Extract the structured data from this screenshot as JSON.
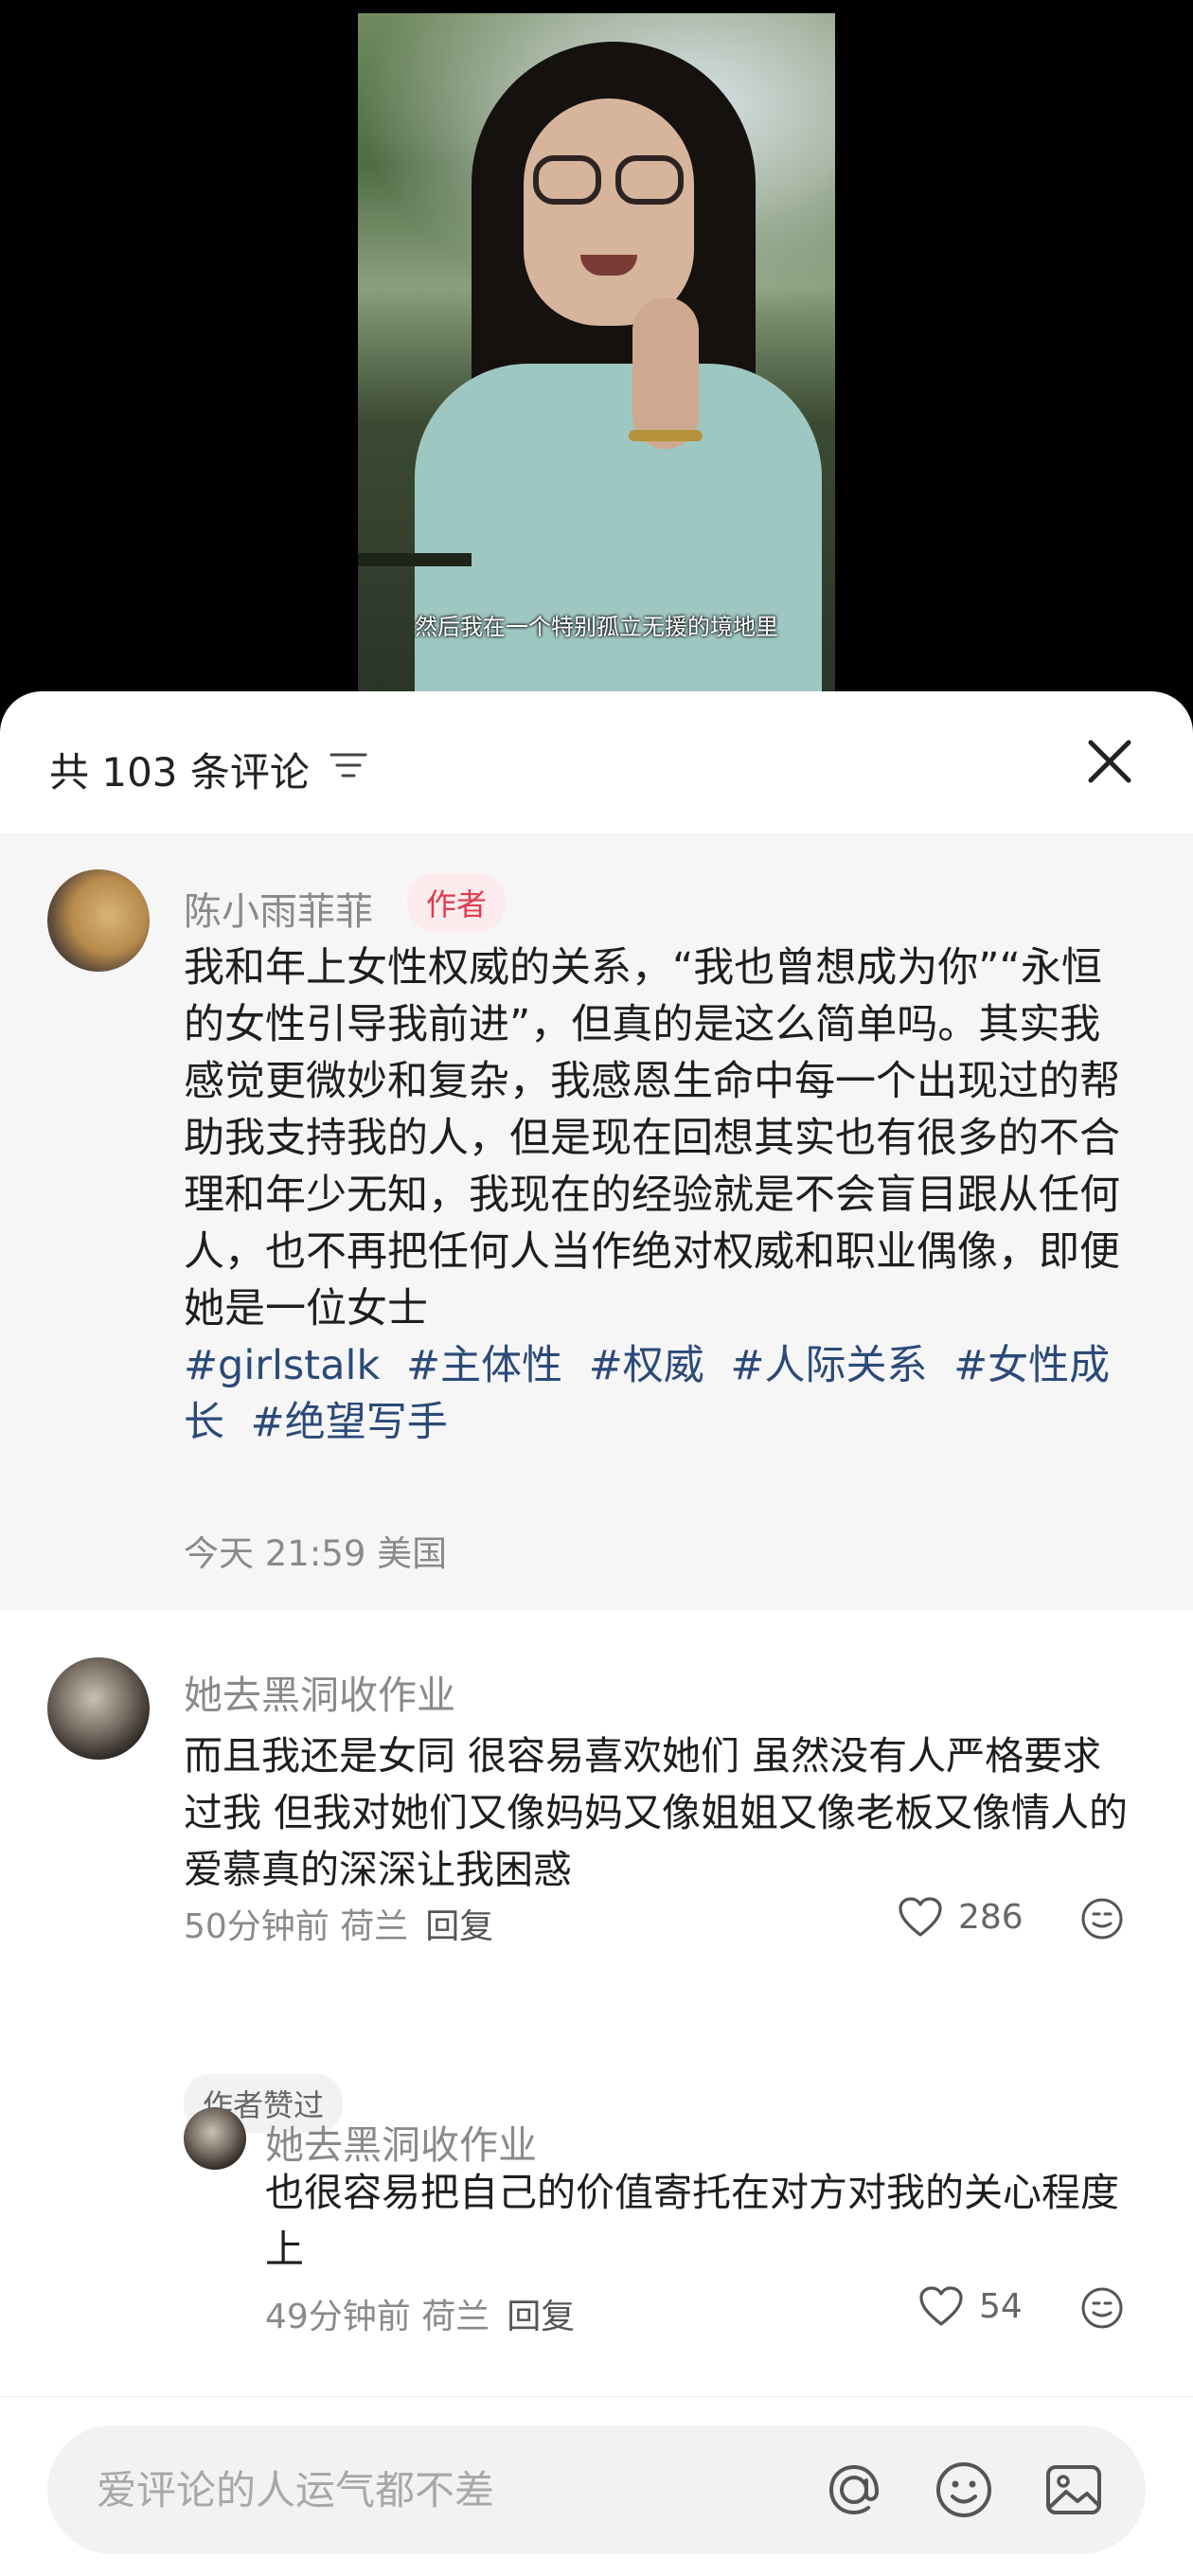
{
  "video": {
    "subtitle": "然后我在一个特别孤立无援的境地里"
  },
  "panel": {
    "title": "共 103 条评论"
  },
  "author_post": {
    "name": "陈小雨菲菲",
    "badge": "作者",
    "text": "我和年上女性权威的关系，“我也曾想成为你”“永恒的女性引导我前进”，但真的是这么简单吗。其实我感觉更微妙和复杂，我感恩生命中每一个出现过的帮助我支持我的人，但是现在回想其实也有很多的不合理和年少无知，我现在的经验就是不会盲目跟从任何人，也不再把任何人当作绝对权威和职业偶像，即便她是一位女士",
    "tags": [
      "#girlstalk",
      "#主体性",
      "#权威",
      "#人际关系",
      "#女性成长",
      "#绝望写手"
    ],
    "meta": "今天 21:59 美国"
  },
  "comments": [
    {
      "name": "她去黑洞收作业",
      "text": "而且我还是女同 很容易喜欢她们 虽然没有人严格要求过我 但我对她们又像妈妈又像姐姐又像老板又像情人的爱慕真的深深让我困惑",
      "time_location": "50分钟前 荷兰",
      "reply_label": "回复",
      "likes": "286",
      "badge": "作者赞过"
    }
  ],
  "replies": [
    {
      "name": "她去黑洞收作业",
      "text": "也很容易把自己的价值寄托在对方对我的关心程度上",
      "time_location": "49分钟前 荷兰",
      "reply_label": "回复",
      "likes": "54"
    }
  ],
  "input": {
    "placeholder": "爱评论的人运气都不差"
  },
  "icons": [
    "sort-icon",
    "close-icon",
    "heart-icon",
    "emoji-icon",
    "at-icon",
    "image-icon"
  ],
  "colors": {
    "author_badge_bg": "#fdeaec",
    "author_badge_text": "#e03a4e",
    "hashtag": "#2b4a78"
  }
}
